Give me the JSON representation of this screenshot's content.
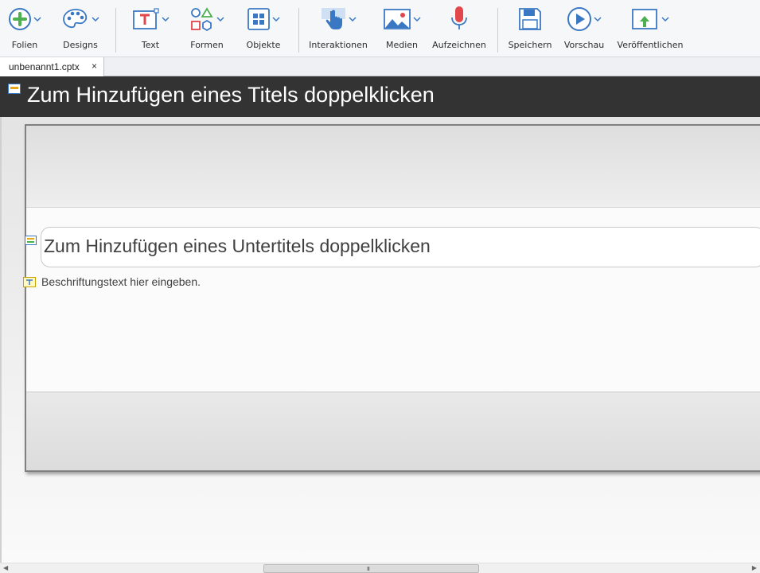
{
  "toolbar": {
    "items": [
      {
        "label": "Folien",
        "icon": "plus-circle-icon"
      },
      {
        "label": "Designs",
        "icon": "palette-icon"
      },
      {
        "label": "Text",
        "icon": "text-box-icon"
      },
      {
        "label": "Formen",
        "icon": "shapes-icon"
      },
      {
        "label": "Objekte",
        "icon": "grid-objects-icon"
      },
      {
        "label": "Interaktionen",
        "icon": "hand-pointer-icon"
      },
      {
        "label": "Medien",
        "icon": "image-icon"
      },
      {
        "label": "Aufzeichnen",
        "icon": "microphone-icon"
      },
      {
        "label": "Speichern",
        "icon": "floppy-disk-icon"
      },
      {
        "label": "Vorschau",
        "icon": "play-circle-icon"
      },
      {
        "label": "Veröffentlichen",
        "icon": "publish-icon"
      }
    ]
  },
  "tabs": [
    {
      "label": "unbenannt1.cptx",
      "close": "×"
    }
  ],
  "slide": {
    "title": "Zum Hinzufügen eines Titels doppelklicken",
    "subtitle": "Zum Hinzufügen eines Untertitels doppelklicken",
    "caption": "Beschriftungstext hier eingeben."
  },
  "scrollbar": {
    "grip": "III"
  },
  "colors": {
    "accent_blue": "#3b78c3",
    "green": "#4caf50",
    "red": "#e2474b",
    "title_bar": "#333333"
  }
}
